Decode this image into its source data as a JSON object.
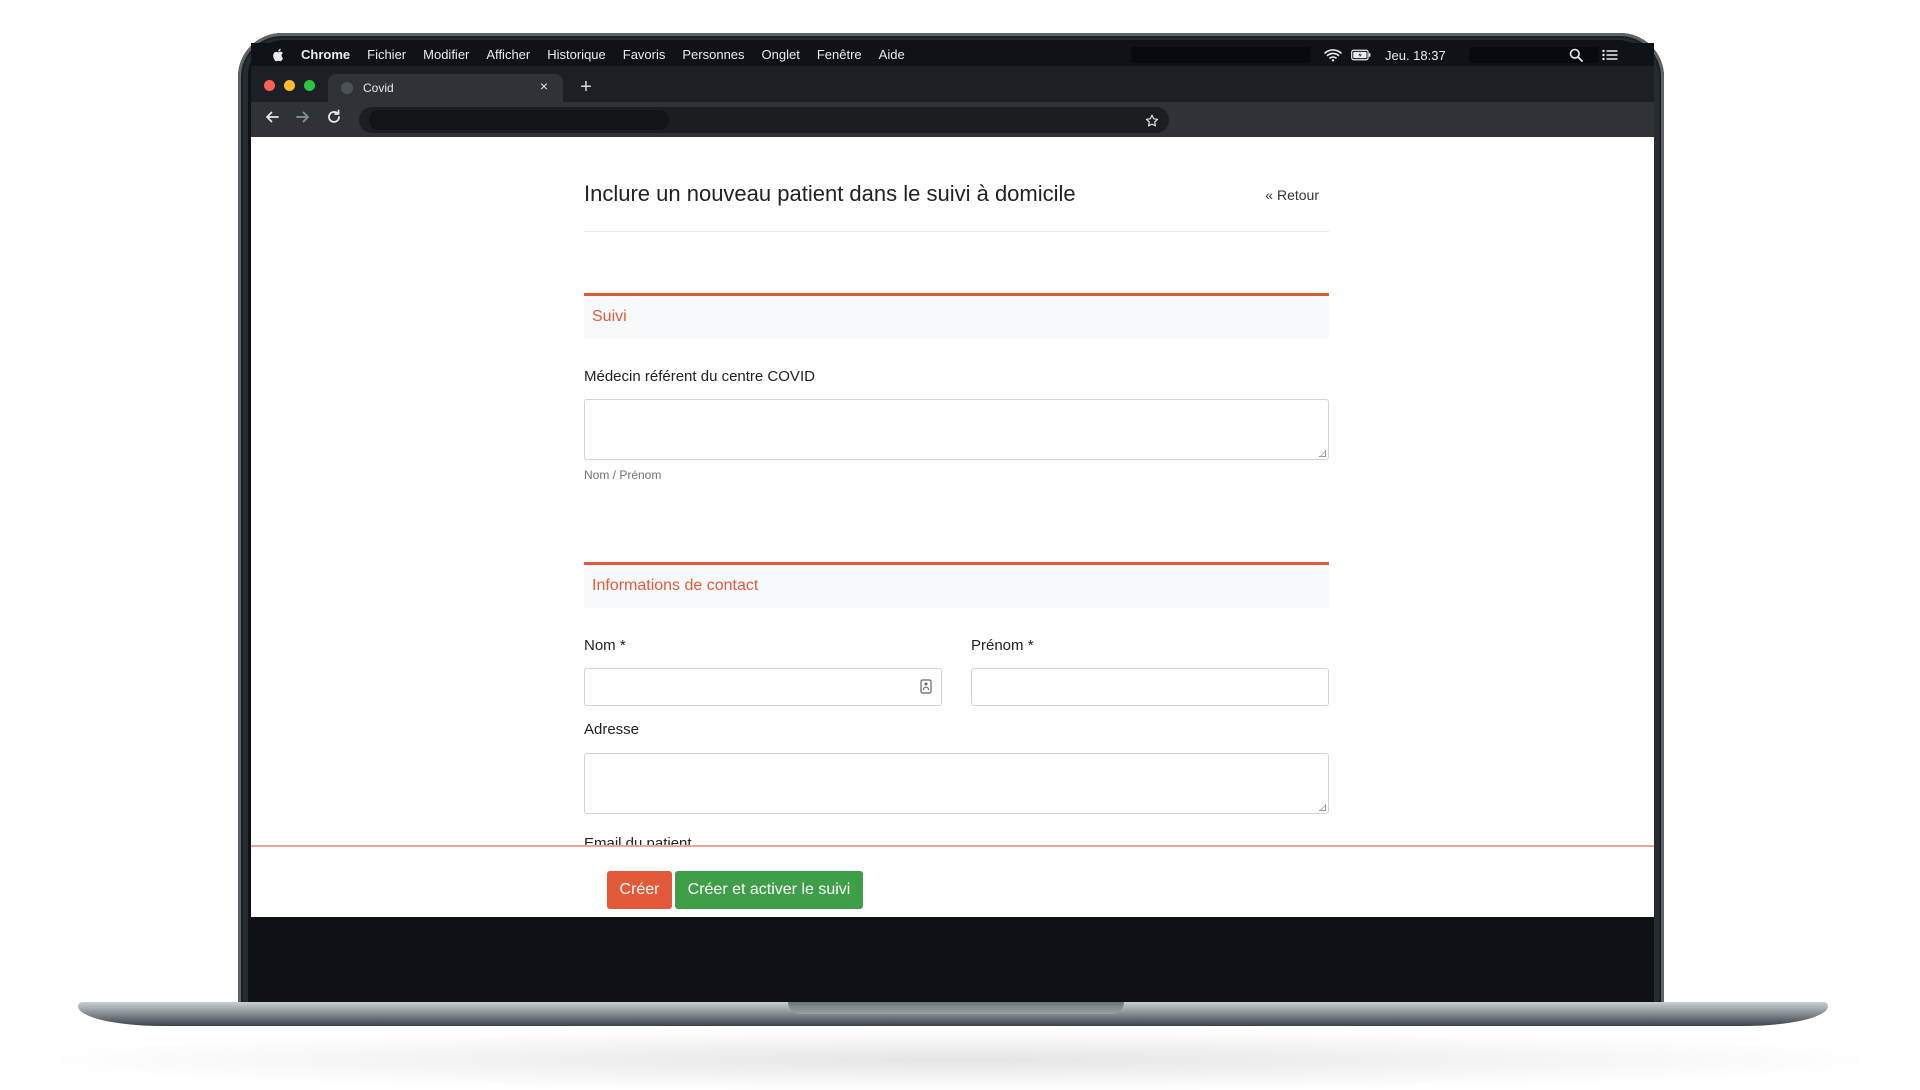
{
  "menubar": {
    "items": [
      "Chrome",
      "Fichier",
      "Modifier",
      "Afficher",
      "Historique",
      "Favoris",
      "Personnes",
      "Onglet",
      "Fenêtre",
      "Aide"
    ],
    "clock": "Jeu. 18:37",
    "icons": [
      "apple-icon",
      "wifi-icon",
      "battery-icon",
      "spotlight-search-icon",
      "control-center-list-icon"
    ]
  },
  "browser": {
    "tab_title": "Covid",
    "tab_close": "×",
    "new_tab": "+",
    "window_controls": {
      "close": "#ff5f57",
      "minimize": "#febc2e",
      "zoom": "#28c840"
    }
  },
  "page": {
    "title": "Inclure un nouveau patient dans le suivi à domicile",
    "back_link": "« Retour",
    "sections": {
      "suivi": "Suivi",
      "contact": "Informations de contact"
    },
    "fields": {
      "medecin_label": "Médecin référent du centre COVID",
      "medecin_value": "",
      "medecin_help": "Nom / Prénom",
      "nom_label": "Nom *",
      "nom_value": "",
      "prenom_label": "Prénom *",
      "prenom_value": "",
      "adresse_label": "Adresse",
      "adresse_value": "",
      "email_label": "Email du patient"
    },
    "buttons": {
      "create": "Créer",
      "create_activate": "Créer et activer le suivi"
    },
    "colors": {
      "accent": "#e35a3b",
      "success": "#3f9e48"
    }
  }
}
